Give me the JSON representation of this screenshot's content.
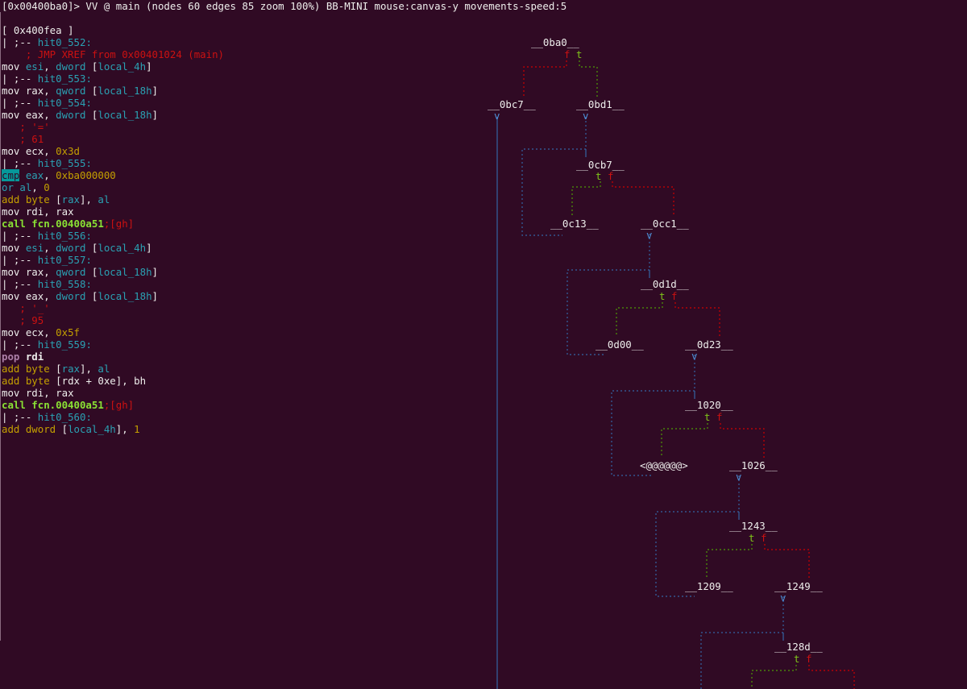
{
  "status_line": "[0x00400ba0]> VV @ main (nodes 60 edges 85 zoom 100%) BB-MINI mouse:canvas-y movements-speed:5",
  "block_header": "[ 0x400fea ]",
  "disasm": {
    "l01_pre": "| ;-- ",
    "l01_lbl": "hit0_552:",
    "l02_cmt": "    ; JMP XREF from 0x00401024 (main)",
    "l03_op": "mov ",
    "l03_reg": "esi",
    "l03_mid": ", ",
    "l03_sz": "dword ",
    "l03_b1": "[",
    "l03_var": "local_4h",
    "l03_b2": "]",
    "l04_pre": "| ;-- ",
    "l04_lbl": "hit0_553:",
    "l05_op": "mov ",
    "l05_reg": "rax",
    "l05_mid": ", ",
    "l05_sz": "qword ",
    "l05_b1": "[",
    "l05_var": "local_18h",
    "l05_b2": "]",
    "l06_pre": "| ;-- ",
    "l06_lbl": "hit0_554:",
    "l07_op": "mov ",
    "l07_reg": "eax",
    "l07_mid": ", ",
    "l07_sz": "dword ",
    "l07_b1": "[",
    "l07_var": "local_18h",
    "l07_b2": "]",
    "l08_cmt": "   ; '='",
    "l09_cmt": "   ; 61",
    "l10_op": "mov ",
    "l10_reg": "ecx",
    "l10_mid": ", ",
    "l10_val": "0x3d",
    "l11_pre": "| ;-- ",
    "l11_lbl": "hit0_555:",
    "l12_op": "cmp",
    "l12_reg": " eax",
    "l12_mid": ", ",
    "l12_val": "0xba000000",
    "l13_op": "or ",
    "l13_reg": "al",
    "l13_mid": ", ",
    "l13_val": "0",
    "l14_op": "add byte ",
    "l14_b1": "[",
    "l14_var": "rax",
    "l14_b2": "]",
    "l14_mid": ", ",
    "l14_reg": "al",
    "l15_op": "mov ",
    "l15_reg": "rdi",
    "l15_mid": ", ",
    "l15_reg2": "rax",
    "l16_op": "call fcn.00400a51",
    "l16_tag": ";[gh]",
    "l17_pre": "| ;-- ",
    "l17_lbl": "hit0_556:",
    "l18_op": "mov ",
    "l18_reg": "esi",
    "l18_mid": ", ",
    "l18_sz": "dword ",
    "l18_b1": "[",
    "l18_var": "local_4h",
    "l18_b2": "]",
    "l19_pre": "| ;-- ",
    "l19_lbl": "hit0_557:",
    "l20_op": "mov ",
    "l20_reg": "rax",
    "l20_mid": ", ",
    "l20_sz": "qword ",
    "l20_b1": "[",
    "l20_var": "local_18h",
    "l20_b2": "]",
    "l21_pre": "| ;-- ",
    "l21_lbl": "hit0_558:",
    "l22_op": "mov ",
    "l22_reg": "eax",
    "l22_mid": ", ",
    "l22_sz": "dword ",
    "l22_b1": "[",
    "l22_var": "local_18h",
    "l22_b2": "]",
    "l23_cmt": "   ; '_'",
    "l24_cmt": "   ; 95",
    "l25_op": "mov ",
    "l25_reg": "ecx",
    "l25_mid": ", ",
    "l25_val": "0x5f",
    "l26_pre": "| ;-- ",
    "l26_lbl": "hit0_559:",
    "l27_op": "pop ",
    "l27_reg": "rdi",
    "l28_op": "add byte ",
    "l28_b1": "[",
    "l28_var": "rax",
    "l28_b2": "]",
    "l28_mid": ", ",
    "l28_reg": "al",
    "l29_op": "add byte ",
    "l29_b1": "[",
    "l29_var": "rdx + 0xe",
    "l29_b2": "]",
    "l29_mid": ", ",
    "l29_reg": "bh",
    "l30_op": "mov ",
    "l30_reg": "rdi",
    "l30_mid": ", ",
    "l30_reg2": "rax",
    "l31_op": "call fcn.00400a51",
    "l31_tag": ";[gh]",
    "l32_pre": "| ;-- ",
    "l32_lbl": "hit0_560:",
    "l33_op": "add dword ",
    "l33_b1": "[",
    "l33_var": "local_4h",
    "l33_b2": "]",
    "l33_mid": ", ",
    "l33_val": "1"
  },
  "graph_nodes": {
    "n0ba0": "__0ba0__",
    "n0bc7": "__0bc7__",
    "n0bd1": "__0bd1__",
    "n0cb7": "__0cb7__",
    "n0c13": "__0c13__",
    "n0cc1": "__0cc1__",
    "n0d1d": "__0d1d__",
    "n0d00": "__0d00__",
    "n0d23": "__0d23__",
    "n1020": "__1020__",
    "nat": "<@@@@@@>",
    "n1026": "__1026__",
    "n1243": "__1243__",
    "n1209": "__1209__",
    "n1249": "__1249__",
    "n128d": "__128d__"
  },
  "branch": {
    "t": "t",
    "f": "f"
  },
  "colors": {
    "background": "#300a24",
    "text": "#eeeeec",
    "edge_blue": "#3465a4",
    "edge_red": "#cc0000",
    "edge_green": "#4e9a06"
  }
}
